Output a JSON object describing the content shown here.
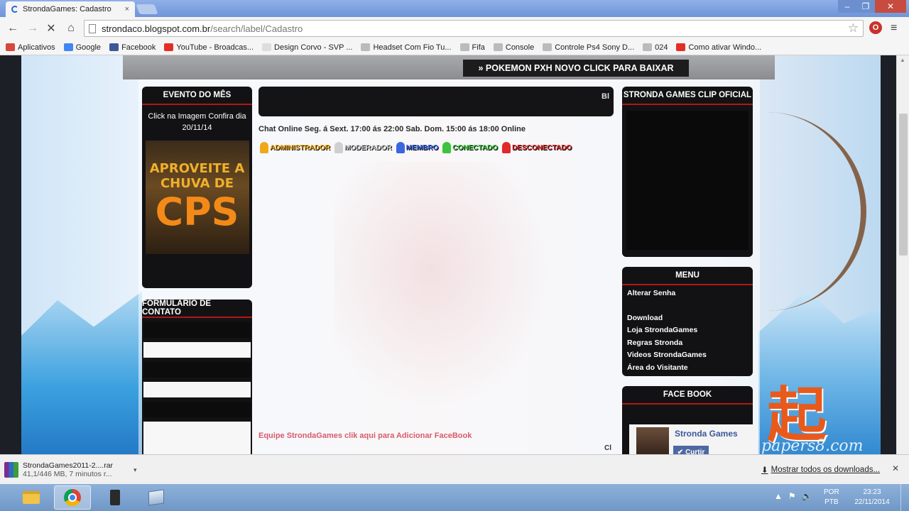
{
  "browser": {
    "tab_title": "StrondaGames: Cadastro",
    "tab_close": "×",
    "url_host": "strondaco.blogspot.com.br",
    "url_path": "/search/label/Cadastro",
    "bookmarks": [
      {
        "label": "Aplicativos",
        "color": "#d64a3a"
      },
      {
        "label": "Google",
        "color": "#4285f4"
      },
      {
        "label": "Facebook",
        "color": "#3b5998"
      },
      {
        "label": "YouTube - Broadcas...",
        "color": "#e52d27"
      },
      {
        "label": "Design Corvo - SVP ...",
        "color": "#dddddd"
      },
      {
        "label": "Headset Com Fio Tu...",
        "color": "#bbbbbb"
      },
      {
        "label": "Fifa",
        "color": "#bbbbbb"
      },
      {
        "label": "Console",
        "color": "#bbbbbb"
      },
      {
        "label": "Controle Ps4 Sony D...",
        "color": "#bbbbbb"
      },
      {
        "label": "024",
        "color": "#bbbbbb"
      },
      {
        "label": "Como ativar Windo...",
        "color": "#e52d27"
      }
    ]
  },
  "page": {
    "notice": "» POKEMON PXH NOVO CLICK PARA BAIXAR",
    "evento": {
      "title": "EVENTO DO MÊS",
      "text": "Click na Imagem Confira dia 20/11/14",
      "banner_l1": "APROVEITE A",
      "banner_l2": "CHUVA DE",
      "banner_l3": "CPS"
    },
    "contato_title": "FORMULÁRIO DE CONTATO",
    "center_bar_text": "Bl",
    "chat_line": "Chat Online Seg. á Sext. 17:00 ás 22:00 Sab. Dom. 15:00 ás 18:00 Online",
    "legend": [
      {
        "label": "ADMINISTRADOR",
        "color": "#f0a818"
      },
      {
        "label": "MODERADOR",
        "color": "#cfcfcf"
      },
      {
        "label": "MEMBRO",
        "color": "#3a66e0"
      },
      {
        "label": "CONECTADO",
        "color": "#3cc43c"
      },
      {
        "label": "DESCONECTADO",
        "color": "#e02a2a"
      }
    ],
    "footer_text": "Equipe StrondaGames clik aqui para Adicionar FaceBook",
    "corner_text": "Cl",
    "clip_title": "STRONDA GAMES CLIP OFICIAL",
    "menu": {
      "title": "MENU",
      "items": [
        "Alterar Senha",
        "",
        "Download",
        "Loja StrondaGames",
        "Regras Stronda",
        "Videos StrondaGames",
        "Área do Visitante"
      ]
    },
    "face": {
      "title": "FACE BOOK",
      "page_name": "Stronda Games",
      "like_label": "Curtir"
    },
    "background_text": "起",
    "watermark": "papers8.com"
  },
  "downloads": {
    "file_name": "StrondaGames2011-2....rar",
    "status": "41,1/446 MB, 7 minutos r...",
    "show_all": "Mostrar todos os downloads..."
  },
  "taskbar": {
    "lang_l1": "POR",
    "lang_l2": "PTB",
    "time": "23:23",
    "date": "22/11/2014"
  }
}
